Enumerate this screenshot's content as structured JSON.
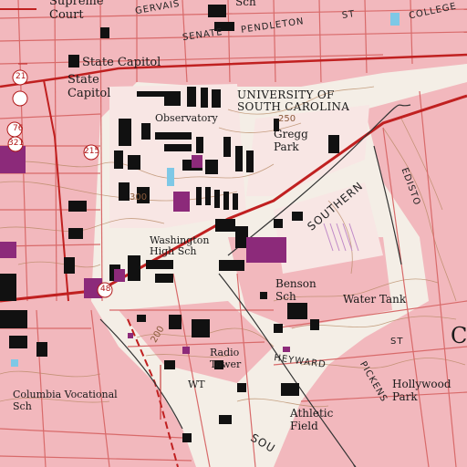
{
  "map": {
    "colors": {
      "paper": "#f4eee6",
      "urban_tint": "#f2b8bd",
      "building": "#111111",
      "school_building": "#8c2a7a",
      "major_road": "#c02020",
      "street": "#d86a6a",
      "contour": "#b58660",
      "water": "#7ec8e6",
      "rail": "#333333"
    },
    "labels": {
      "supreme_court": "Supreme\nCourt",
      "gervais_st": "GERVAIS",
      "sch_top": "Sch",
      "college_st": "COLLEGE",
      "senate_st": "SENATE",
      "pendleton_st": "PENDLETON",
      "st_top": "ST",
      "state_capitol_1": "State Capitol",
      "state_capitol_2": "State\nCapitol",
      "university": "UNIVERSITY OF\nSOUTH CAROLINA",
      "observatory": "Observatory",
      "gregg_park": "Gregg\nPark",
      "contour_250": "250",
      "contour_300": "300",
      "contour_200": "200",
      "route_215": "215",
      "route_21": "21",
      "route_76": "76",
      "route_321": "321",
      "route_48": "48",
      "southern": "SOUTHERN",
      "washington_high": "Washington\nHigh Sch",
      "benson_sch": "Benson\nSch",
      "water_tank": "Water Tank",
      "radio_tower": "Radio\nTower",
      "wt": "WT",
      "heyward": "HEYWARD",
      "st_heyward": "ST",
      "columbia_vocational": "Columbia Vocational\nSch",
      "hollywood_park": "Hollywood\nPark",
      "athletic_field": "Athletic\nField",
      "pickens": "PICKENS",
      "edisto": "EDISTO",
      "sou": "SOU",
      "cut_c": "C"
    }
  }
}
